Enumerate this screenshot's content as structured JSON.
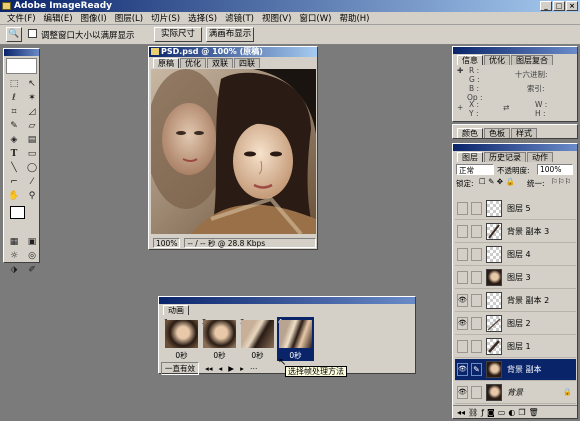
{
  "app": {
    "title": "Adobe ImageReady"
  },
  "menu": [
    "文件(F)",
    "编辑(E)",
    "图像(I)",
    "图层(L)",
    "切片(S)",
    "选择(S)",
    "滤镜(T)",
    "视图(V)",
    "窗口(W)",
    "帮助(H)"
  ],
  "options": {
    "checkbox_label": "调整窗口大小以满屏显示",
    "actual_pixels": "实际尺寸",
    "fit_screen": "满画布显示"
  },
  "document": {
    "title": "PSD.psd @ 100% (原稿)",
    "tabs": [
      "原稿",
      "优化",
      "双联",
      "四联"
    ],
    "zoom": "100%",
    "status": "-- / -- 秒 @ 28.8 Kbps"
  },
  "info": {
    "tabs": [
      "信息",
      "优化",
      "图层复合"
    ],
    "r": "R :",
    "g": "G :",
    "b": "B :",
    "op": "Op :",
    "hex": "十六进制:",
    "index": "索引:",
    "x": "X :",
    "y": "Y :",
    "w": "W :",
    "h": "H :"
  },
  "swatches": {
    "tabs": [
      "颜色",
      "色板",
      "样式"
    ]
  },
  "layers": {
    "tabs": [
      "图层",
      "历史记录",
      "动作"
    ],
    "blend_mode": "正常",
    "opacity_label": "不透明度:",
    "opacity": "100%",
    "lock_label": "锁定:",
    "unify_label": "统一:",
    "items": [
      {
        "name": "图层 5",
        "visible": false,
        "thumb": "checker"
      },
      {
        "name": "背景 副本 3",
        "visible": false,
        "thumb": "stroke"
      },
      {
        "name": "图层 4",
        "visible": false,
        "thumb": "checker"
      },
      {
        "name": "图层 3",
        "visible": false,
        "thumb": "face"
      },
      {
        "name": "背景 副本 2",
        "visible": true,
        "thumb": "checker"
      },
      {
        "name": "图层 2",
        "visible": true,
        "thumb": "checker"
      },
      {
        "name": "图层 1",
        "visible": false,
        "thumb": "stroke"
      },
      {
        "name": "背景 副本",
        "visible": true,
        "thumb": "face",
        "selected": true
      },
      {
        "name": "背景",
        "visible": true,
        "thumb": "face",
        "locked": true
      }
    ]
  },
  "animation": {
    "title": "动画",
    "loop": "一直有效",
    "frames": [
      {
        "num": "1",
        "delay": "0秒"
      },
      {
        "num": "2",
        "delay": "0秒"
      },
      {
        "num": "3",
        "delay": "0秒"
      },
      {
        "num": "4",
        "delay": "0秒"
      }
    ],
    "selected_frame": 4,
    "tooltip": "选择帧处理方法"
  },
  "colors": {
    "accent": "#0a246a",
    "panel": "#d4d0c8",
    "workspace": "#7b7b7b"
  }
}
